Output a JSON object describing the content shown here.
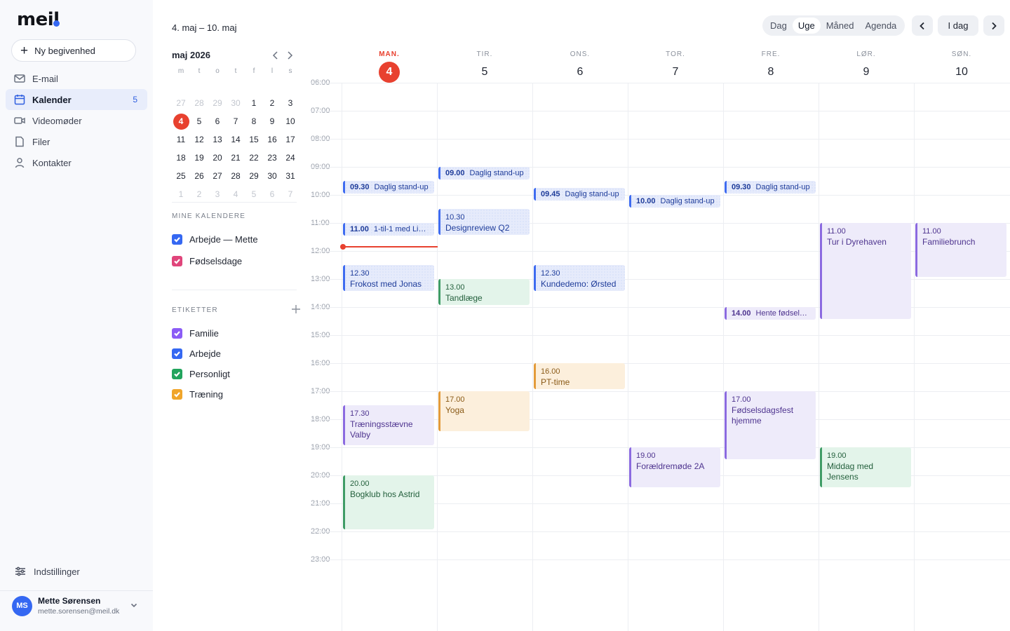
{
  "app": {
    "logo": "meil",
    "new_event": "Ny begivenhed",
    "nav": [
      {
        "label": "E-mail",
        "icon": "mail-icon",
        "badge": ""
      },
      {
        "label": "Kalender",
        "icon": "calendar-icon",
        "badge": "5"
      },
      {
        "label": "Videomøder",
        "icon": "video-icon",
        "badge": ""
      },
      {
        "label": "Filer",
        "icon": "file-icon",
        "badge": ""
      },
      {
        "label": "Kontakter",
        "icon": "person-icon",
        "badge": ""
      }
    ],
    "settings": "Indstillinger",
    "user": {
      "initials": "MS",
      "name": "Mette Sørensen",
      "email": "mette.sorensen@meil.dk"
    }
  },
  "range_title": "4. maj – 10. maj",
  "mini_calendar": {
    "title": "maj 2026",
    "weekdays": [
      "m",
      "t",
      "o",
      "t",
      "f",
      "l",
      "s"
    ],
    "weeks": [
      [
        "27",
        "28",
        "29",
        "30",
        "1",
        "2",
        "3"
      ],
      [
        "4",
        "5",
        "6",
        "7",
        "8",
        "9",
        "10"
      ],
      [
        "11",
        "12",
        "13",
        "14",
        "15",
        "16",
        "17"
      ],
      [
        "18",
        "19",
        "20",
        "21",
        "22",
        "23",
        "24"
      ],
      [
        "25",
        "26",
        "27",
        "28",
        "29",
        "30",
        "31"
      ],
      [
        "1",
        "2",
        "3",
        "4",
        "5",
        "6",
        "7"
      ]
    ]
  },
  "calendars": {
    "title": "MINE KALENDERE",
    "items": [
      {
        "label": "Arbejde — Mette",
        "color": "#3568f2"
      },
      {
        "label": "Fødselsdage",
        "color": "#e0457b"
      }
    ]
  },
  "labels": {
    "title": "ETIKETTER",
    "items": [
      {
        "label": "Familie",
        "color": "#8b5cf6"
      },
      {
        "label": "Arbejde",
        "color": "#3568f2"
      },
      {
        "label": "Personligt",
        "color": "#22a45d"
      },
      {
        "label": "Træning",
        "color": "#f0a52a"
      }
    ]
  },
  "toolbar": {
    "views": [
      "Dag",
      "Uge",
      "Måned",
      "Agenda"
    ],
    "active_view": "Uge",
    "today": "I dag"
  },
  "days": [
    {
      "dow": "MAN.",
      "num": "4"
    },
    {
      "dow": "TIR.",
      "num": "5"
    },
    {
      "dow": "ONS.",
      "num": "6"
    },
    {
      "dow": "TOR.",
      "num": "7"
    },
    {
      "dow": "FRE.",
      "num": "8"
    },
    {
      "dow": "LØR.",
      "num": "9"
    },
    {
      "dow": "SØN.",
      "num": "10"
    }
  ],
  "hours": [
    "06:00",
    "07:00",
    "08:00",
    "09:00",
    "10:00",
    "11:00",
    "12:00",
    "13:00",
    "14:00",
    "15:00",
    "16:00",
    "17:00",
    "18:00",
    "19:00",
    "20:00",
    "21:00",
    "22:00",
    "23:00"
  ],
  "events": [
    {
      "day": 0,
      "start": 9.5,
      "end": 10,
      "time": "09.30",
      "title": "Daglig stand-up",
      "cat": "work",
      "inline": true
    },
    {
      "day": 1,
      "start": 9.0,
      "end": 9.5,
      "time": "09.00",
      "title": "Daglig stand-up",
      "cat": "work",
      "inline": true
    },
    {
      "day": 2,
      "start": 9.75,
      "end": 10.25,
      "time": "09.45",
      "title": "Daglig stand-up",
      "cat": "work",
      "inline": true
    },
    {
      "day": 3,
      "start": 10.0,
      "end": 10.5,
      "time": "10.00",
      "title": "Daglig stand-up",
      "cat": "work",
      "inline": true
    },
    {
      "day": 4,
      "start": 9.5,
      "end": 10,
      "time": "09.30",
      "title": "Daglig stand-up",
      "cat": "work",
      "inline": true
    },
    {
      "day": 1,
      "start": 10.5,
      "end": 11.5,
      "time": "10.30",
      "title": "Designreview Q2",
      "cat": "work",
      "inline": false
    },
    {
      "day": 0,
      "start": 11.0,
      "end": 11.5,
      "time": "11.00",
      "title": "1-til-1 med Li…",
      "cat": "work",
      "inline": true
    },
    {
      "day": 0,
      "start": 12.5,
      "end": 13.5,
      "time": "12.30",
      "title": "Frokost med Jonas",
      "cat": "work",
      "inline": false
    },
    {
      "day": 1,
      "start": 13.0,
      "end": 14.0,
      "time": "13.00",
      "title": "Tandlæge",
      "cat": "health",
      "inline": false
    },
    {
      "day": 2,
      "start": 12.5,
      "end": 13.5,
      "time": "12.30",
      "title": "Kundedemo: Ørsted",
      "cat": "work",
      "inline": false
    },
    {
      "day": 4,
      "start": 14.0,
      "end": 14.5,
      "time": "14.00",
      "title": "Hente fødselsd…",
      "cat": "fam",
      "inline": true
    },
    {
      "day": 5,
      "start": 11.0,
      "end": 14.5,
      "time": "11.00",
      "title": "Tur i Dyrehaven",
      "cat": "fam",
      "inline": false
    },
    {
      "day": 6,
      "start": 11.0,
      "end": 13.0,
      "time": "11.00",
      "title": "Familiebrunch",
      "cat": "fam",
      "inline": false
    },
    {
      "day": 2,
      "start": 16.0,
      "end": 17.0,
      "time": "16.00",
      "title": "PT-time",
      "cat": "train",
      "inline": false
    },
    {
      "day": 1,
      "start": 17.0,
      "end": 18.5,
      "time": "17.00",
      "title": "Yoga",
      "cat": "train",
      "inline": false
    },
    {
      "day": 0,
      "start": 17.5,
      "end": 19.0,
      "time": "17.30",
      "title": "Træningsstævne Valby",
      "cat": "fam",
      "inline": false
    },
    {
      "day": 4,
      "start": 17.0,
      "end": 19.5,
      "time": "17.00",
      "title": "Fødselsdagsfest hjemme",
      "cat": "fam",
      "inline": false
    },
    {
      "day": 3,
      "start": 19.0,
      "end": 20.5,
      "time": "19.00",
      "title": "Forældremøde 2A",
      "cat": "fam",
      "inline": false
    },
    {
      "day": 5,
      "start": 19.0,
      "end": 20.5,
      "time": "19.00",
      "title": "Middag med Jensens",
      "cat": "health",
      "inline": false
    },
    {
      "day": 0,
      "start": 20.0,
      "end": 22.0,
      "time": "20.00",
      "title": "Bogklub hos Astrid",
      "cat": "health",
      "inline": false
    }
  ],
  "now_time": 12.0
}
